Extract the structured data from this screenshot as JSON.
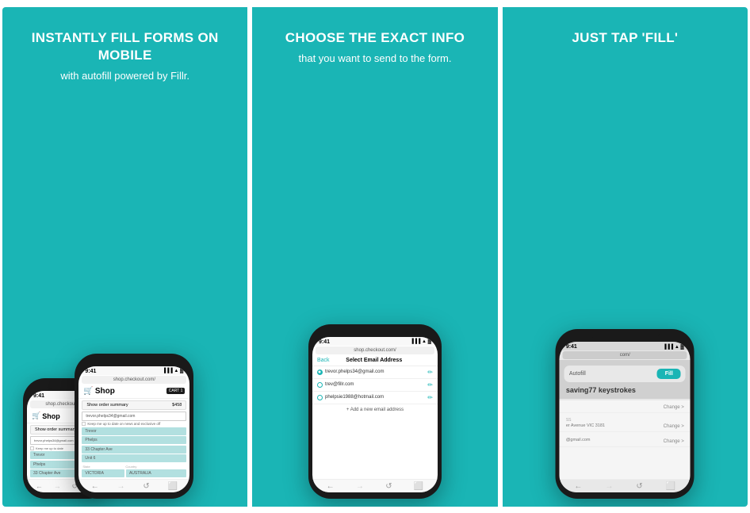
{
  "panels": [
    {
      "id": "panel1",
      "title": "INSTANTLY FILL FORMS ON MOBILE",
      "subtitle": "with autofill powered by Fillr.",
      "phone_small": {
        "time": "9:41",
        "url": "shop.checkout.com/",
        "shop_title": "Shop",
        "cart_label": "CART 1",
        "order_summary": "Show order summary",
        "order_price": "$458",
        "email": "trevor.phelps34@gmail.com",
        "checkbox_text": "Keep me up to date on news and exclusive off",
        "fields": [
          "Trevor",
          "Phelps",
          "33 Chapter Ave",
          "Unit 6"
        ],
        "fields2": [
          "VICTORIA",
          "AUSTRALIA"
        ]
      },
      "phone_main": {
        "time": "9:41",
        "url": "shop.checkout.com/",
        "shop_title": "Shop",
        "cart_label": "CART 1",
        "order_summary": "Show order summary",
        "order_price": "$458",
        "email": "trevor.phelps34@gmail.com",
        "checkbox_text": "Keep me up to date on news and exclusive off",
        "fields": [
          "Trevor",
          "Phelps",
          "33 Chapter Ave",
          "Unit 6"
        ],
        "fields2": [
          "VICTORIA",
          "AUSTRALIA"
        ]
      }
    },
    {
      "id": "panel2",
      "title": "CHOOSE THE EXACT INFO",
      "subtitle": "that you want to send to the form.",
      "phone": {
        "time": "9:41",
        "url": "shop.checkout.com/",
        "back": "Back",
        "header": "Select Email Address",
        "emails": [
          {
            "address": "trevor.phelps34@gmail.com",
            "selected": true
          },
          {
            "address": "trev@fillr.com",
            "selected": false
          },
          {
            "address": "phelpsie1988@hotmail.com",
            "selected": false
          }
        ],
        "add_email": "+ Add a new email address"
      }
    },
    {
      "id": "panel3",
      "title": "JUST TAP 'FILL'",
      "subtitle": "",
      "phone": {
        "time": "9:41",
        "url": "com/",
        "autofill_label": "Autofill",
        "fill_btn": "Fill",
        "keystroke_prefix": "saving",
        "keystroke_number": "77",
        "keystroke_suffix": "keystrokes",
        "rows": [
          {
            "label": "",
            "value": "",
            "change": "Change >"
          },
          {
            "label": "SS",
            "value": "er Avenue VIC 3181",
            "change": "Change >"
          },
          {
            "label": "",
            "value": "@gmail.com",
            "change": "Change >"
          }
        ]
      }
    }
  ],
  "icons": {
    "cart": "🛒",
    "arrow_left": "←",
    "arrow_right": "→",
    "refresh": "↺",
    "share": "⬜"
  }
}
